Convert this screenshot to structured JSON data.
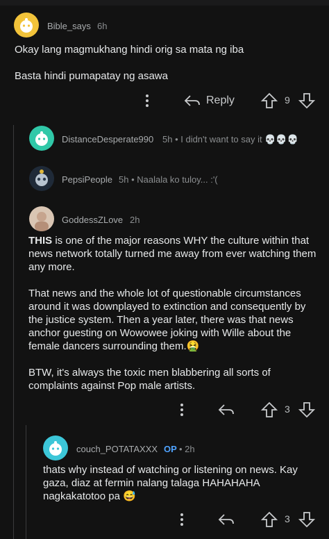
{
  "comments": [
    {
      "username": "Bible_says",
      "time": "6h",
      "paragraphs": [
        "Okay lang magmukhang hindi orig sa mata ng iba",
        "Basta hindi pumapatay ng asawa"
      ],
      "reply_label": "Reply",
      "votes": "9"
    },
    {
      "username": "DistanceDesperate990",
      "meta": "5h • I didn't want to say it 💀💀💀"
    },
    {
      "username": "PepsiPeople",
      "meta": "5h • Naalala ko tuloy... :'("
    },
    {
      "username": "GoddessZLove",
      "time": "2h",
      "bold_lead": "THIS",
      "paragraphs": [
        " is one of the major reasons WHY the culture within that news network totally turned me away from ever watching them any more.",
        "That news and the whole lot of questionable circumstances around it was downplayed to extinction and consequently by the justice system. Then a year later, there was that news anchor guesting on Wowowee joking with Wille about the female dancers surrounding them.🤮",
        "BTW, it's always the toxic men blabbering all sorts of complaints against Pop male artists."
      ],
      "votes": "3"
    },
    {
      "username": "couch_POTATAXXX",
      "op_badge": "OP",
      "time": "• 2h",
      "paragraphs": [
        "thats why instead of watching or listening on news. Kay gaza, diaz at fermin nalang talaga HAHAHAHA nagkakatotoo pa 😅"
      ],
      "votes": "3"
    }
  ],
  "colors": {
    "background": "#121212",
    "op_badge": "#4fa3ff",
    "text": "#e7e9ea",
    "meta": "#8b8e90"
  },
  "icons": [
    "more-options-icon",
    "reply-arrow-icon",
    "upvote-icon",
    "downvote-icon"
  ]
}
